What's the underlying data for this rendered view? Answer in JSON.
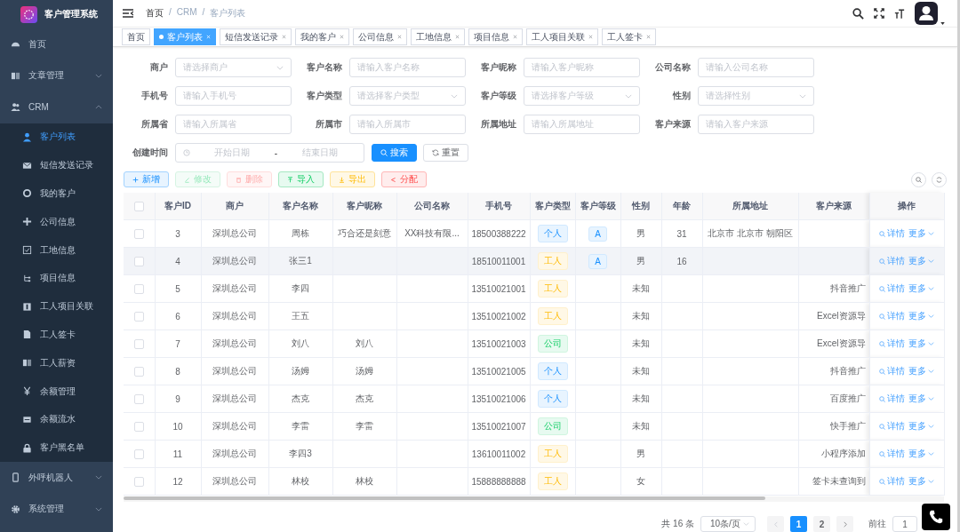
{
  "app": {
    "title": "客户管理系统"
  },
  "sidebar": {
    "items": [
      {
        "label": "首页",
        "kind": "link",
        "selected": false
      },
      {
        "label": "文章管理",
        "kind": "group",
        "expanded": false,
        "selected": false
      },
      {
        "label": "CRM",
        "kind": "group",
        "expanded": true,
        "selected": false,
        "children": [
          {
            "label": "客户列表",
            "selected": true
          },
          {
            "label": "短信发送记录",
            "selected": false
          },
          {
            "label": "我的客户",
            "selected": false
          },
          {
            "label": "公司信息",
            "selected": false
          },
          {
            "label": "工地信息",
            "selected": false
          },
          {
            "label": "项目信息",
            "selected": false
          },
          {
            "label": "工人项目关联",
            "selected": false
          },
          {
            "label": "工人签卡",
            "selected": false
          },
          {
            "label": "工人薪资",
            "selected": false
          },
          {
            "label": "余额管理",
            "selected": false
          },
          {
            "label": "余额流水",
            "selected": false
          },
          {
            "label": "客户黑名单",
            "selected": false
          }
        ]
      },
      {
        "label": "外呼机器人",
        "kind": "group",
        "expanded": false,
        "selected": false
      },
      {
        "label": "系统管理",
        "kind": "group",
        "expanded": false,
        "selected": false
      }
    ]
  },
  "breadcrumb": [
    "首页",
    "CRM",
    "客户列表"
  ],
  "breadcrumb_separator": "/",
  "tabs": [
    {
      "label": "首页",
      "selected": false,
      "closable": false
    },
    {
      "label": "客户列表",
      "selected": true,
      "closable": true
    },
    {
      "label": "短信发送记录",
      "selected": false,
      "closable": true
    },
    {
      "label": "我的客户",
      "selected": false,
      "closable": true
    },
    {
      "label": "公司信息",
      "selected": false,
      "closable": true
    },
    {
      "label": "工地信息",
      "selected": false,
      "closable": true
    },
    {
      "label": "项目信息",
      "selected": false,
      "closable": true
    },
    {
      "label": "工人项目关联",
      "selected": false,
      "closable": true
    },
    {
      "label": "工人签卡",
      "selected": false,
      "closable": true
    }
  ],
  "filters": [
    {
      "label": "商户",
      "kind": "select",
      "placeholder": "请选择商户"
    },
    {
      "label": "客户名称",
      "kind": "input",
      "placeholder": "请输入客户名称"
    },
    {
      "label": "客户昵称",
      "kind": "input",
      "placeholder": "请输入客户昵称"
    },
    {
      "label": "公司名称",
      "kind": "input",
      "placeholder": "请输入公司名称"
    },
    {
      "label": "手机号",
      "kind": "input",
      "placeholder": "请输入手机号"
    },
    {
      "label": "客户类型",
      "kind": "select",
      "placeholder": "请选择客户类型"
    },
    {
      "label": "客户等级",
      "kind": "select",
      "placeholder": "请选择客户等级"
    },
    {
      "label": "性别",
      "kind": "select",
      "placeholder": "请选择性别"
    },
    {
      "label": "所属省",
      "kind": "input",
      "placeholder": "请输入所属省"
    },
    {
      "label": "所属市",
      "kind": "input",
      "placeholder": "请输入所属市"
    },
    {
      "label": "所属地址",
      "kind": "input",
      "placeholder": "请输入所属地址"
    },
    {
      "label": "客户来源",
      "kind": "input",
      "placeholder": "请输入客户来源"
    }
  ],
  "date_range": {
    "label": "创建时间",
    "start_placeholder": "开始日期",
    "separator": "-",
    "end_placeholder": "结束日期"
  },
  "search_button": "搜索",
  "reset_button": "重置",
  "toolbar": [
    {
      "label": "新增",
      "kind": "primary",
      "disabled": false
    },
    {
      "label": "修改",
      "kind": "success",
      "disabled": true
    },
    {
      "label": "删除",
      "kind": "danger",
      "disabled": true
    },
    {
      "label": "导入",
      "kind": "info",
      "disabled": false
    },
    {
      "label": "导出",
      "kind": "warning",
      "disabled": false
    },
    {
      "label": "分配",
      "kind": "danger",
      "disabled": false
    }
  ],
  "table": {
    "select_all_checked": false,
    "columns": [
      "客户ID",
      "商户",
      "客户名称",
      "客户昵称",
      "公司名称",
      "手机号",
      "客户类型",
      "客户等级",
      "性别",
      "年龄",
      "所属地址",
      "客户来源",
      "操作"
    ],
    "rows": [
      {
        "checked": false,
        "selected": false,
        "id": "3",
        "merchant": "深圳总公司",
        "name": "周栋",
        "nickname": "巧合还是刻意",
        "company": "XX科技有限...",
        "phone": "18500388222",
        "type": {
          "label": "个人",
          "kind": "personal"
        },
        "level": "A",
        "gender": "男",
        "age": "31",
        "address": "北京市 北京市 朝阳区",
        "source": "",
        "actions": [
          "详情",
          "更多"
        ]
      },
      {
        "checked": false,
        "selected": true,
        "id": "4",
        "merchant": "深圳总公司",
        "name": "张三1",
        "nickname": "",
        "company": "",
        "phone": "18510011001",
        "type": {
          "label": "工人",
          "kind": "worker"
        },
        "level": "A",
        "gender": "男",
        "age": "16",
        "address": "",
        "source": "",
        "actions": [
          "详情",
          "更多"
        ]
      },
      {
        "checked": false,
        "selected": false,
        "id": "5",
        "merchant": "深圳总公司",
        "name": "李四",
        "nickname": "",
        "company": "",
        "phone": "13510021001",
        "type": {
          "label": "工人",
          "kind": "worker"
        },
        "level": "",
        "gender": "未知",
        "age": "",
        "address": "",
        "source": "抖音推广",
        "actions": [
          "详情",
          "更多"
        ]
      },
      {
        "checked": false,
        "selected": false,
        "id": "6",
        "merchant": "深圳总公司",
        "name": "王五",
        "nickname": "",
        "company": "",
        "phone": "13510021002",
        "type": {
          "label": "工人",
          "kind": "worker"
        },
        "level": "",
        "gender": "未知",
        "age": "",
        "address": "",
        "source": "Excel资源导",
        "actions": [
          "详情",
          "更多"
        ]
      },
      {
        "checked": false,
        "selected": false,
        "id": "7",
        "merchant": "深圳总公司",
        "name": "刘八",
        "nickname": "刘八",
        "company": "",
        "phone": "13510021003",
        "type": {
          "label": "公司",
          "kind": "company"
        },
        "level": "",
        "gender": "未知",
        "age": "",
        "address": "",
        "source": "Excel资源导",
        "actions": [
          "详情",
          "更多"
        ]
      },
      {
        "checked": false,
        "selected": false,
        "id": "8",
        "merchant": "深圳总公司",
        "name": "汤姆",
        "nickname": "汤姆",
        "company": "",
        "phone": "13510021005",
        "type": {
          "label": "个人",
          "kind": "personal"
        },
        "level": "",
        "gender": "未知",
        "age": "",
        "address": "",
        "source": "抖音推广",
        "actions": [
          "详情",
          "更多"
        ]
      },
      {
        "checked": false,
        "selected": false,
        "id": "9",
        "merchant": "深圳总公司",
        "name": "杰克",
        "nickname": "杰克",
        "company": "",
        "phone": "13510021006",
        "type": {
          "label": "个人",
          "kind": "personal"
        },
        "level": "",
        "gender": "未知",
        "age": "",
        "address": "",
        "source": "百度推广",
        "actions": [
          "详情",
          "更多"
        ]
      },
      {
        "checked": false,
        "selected": false,
        "id": "10",
        "merchant": "深圳总公司",
        "name": "李雷",
        "nickname": "李雷",
        "company": "",
        "phone": "13510021007",
        "type": {
          "label": "公司",
          "kind": "company"
        },
        "level": "",
        "gender": "未知",
        "age": "",
        "address": "",
        "source": "快手推广",
        "actions": [
          "详情",
          "更多"
        ]
      },
      {
        "checked": false,
        "selected": false,
        "id": "11",
        "merchant": "深圳总公司",
        "name": "李四3",
        "nickname": "",
        "company": "",
        "phone": "13610011002",
        "type": {
          "label": "工人",
          "kind": "worker"
        },
        "level": "",
        "gender": "男",
        "age": "",
        "address": "",
        "source": "小程序添加",
        "actions": [
          "详情",
          "更多"
        ]
      },
      {
        "checked": false,
        "selected": false,
        "id": "12",
        "merchant": "深圳总公司",
        "name": "林校",
        "nickname": "林校",
        "company": "",
        "phone": "15888888888",
        "type": {
          "label": "工人",
          "kind": "worker"
        },
        "level": "",
        "gender": "女",
        "age": "",
        "address": "",
        "source": "签卡未查询到",
        "actions": [
          "详情",
          "更多"
        ]
      }
    ]
  },
  "pagination": {
    "total": "共 16 条",
    "page_size": "10条/页",
    "pages": [
      {
        "label": "1",
        "selected": true
      },
      {
        "label": "2",
        "selected": false
      }
    ],
    "goto_label": "前往",
    "goto_value": "1"
  }
}
